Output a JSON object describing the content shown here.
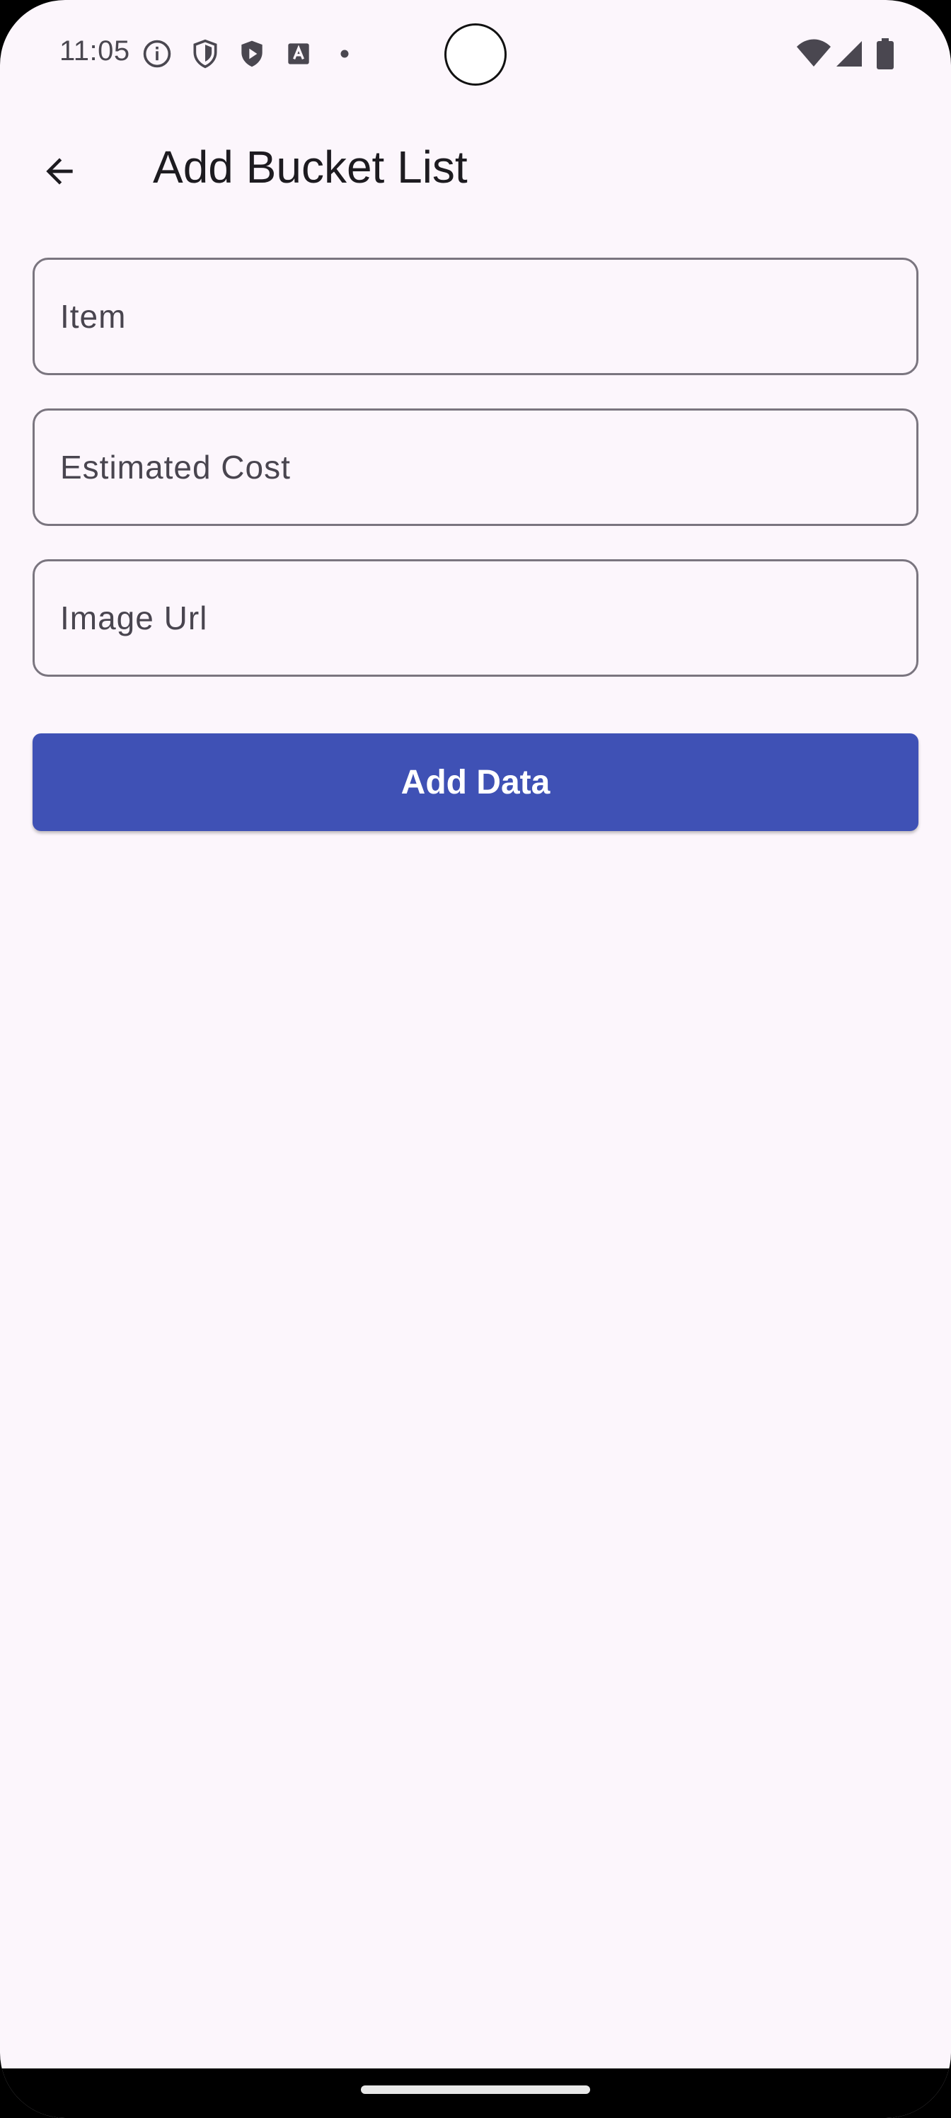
{
  "status_bar": {
    "time": "11:05",
    "left_icons": [
      "info-icon",
      "shield-icon",
      "play-shield-icon",
      "font-a-icon",
      "dot-icon"
    ],
    "right_icons": [
      "wifi-icon",
      "cellular-signal-icon",
      "battery-icon"
    ]
  },
  "app_bar": {
    "back_icon": "arrow-back-icon",
    "title": "Add Bucket List"
  },
  "form": {
    "item": {
      "value": "",
      "placeholder": "Item"
    },
    "estimated_cost": {
      "value": "",
      "placeholder": "Estimated Cost"
    },
    "image_url": {
      "value": "",
      "placeholder": "Image Url"
    },
    "submit_label": "Add Data"
  },
  "colors": {
    "background": "#fcf6fc",
    "primary_button": "#3f51b5",
    "field_border": "#7a757f",
    "title_text": "#1d1b20"
  }
}
